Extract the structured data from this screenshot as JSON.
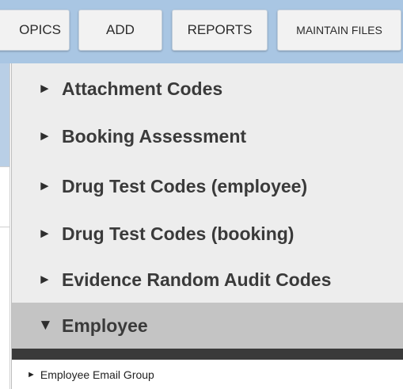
{
  "nav": {
    "buttons": [
      {
        "label": "OPICS"
      },
      {
        "label": "ADD"
      },
      {
        "label": "REPORTS"
      },
      {
        "label": "MAINTAIN FILES"
      }
    ]
  },
  "menu": {
    "collapsed_glyph": "►",
    "expanded_glyph": "▼",
    "items": [
      {
        "label": "Attachment Codes"
      },
      {
        "label": "Booking Assessment"
      },
      {
        "label": "Drug Test Codes (employee)"
      },
      {
        "label": "Drug Test Codes (booking)"
      },
      {
        "label": "Evidence Random Audit Codes"
      },
      {
        "label": "Employee",
        "expanded": true
      }
    ],
    "subitems": [
      {
        "label": "Employee Email Group"
      }
    ]
  },
  "colors": {
    "navbar": "#a9c6e3",
    "menu_bg": "#ededed",
    "active_item": "#c4c4c4",
    "divider": "#3a3a3a"
  }
}
